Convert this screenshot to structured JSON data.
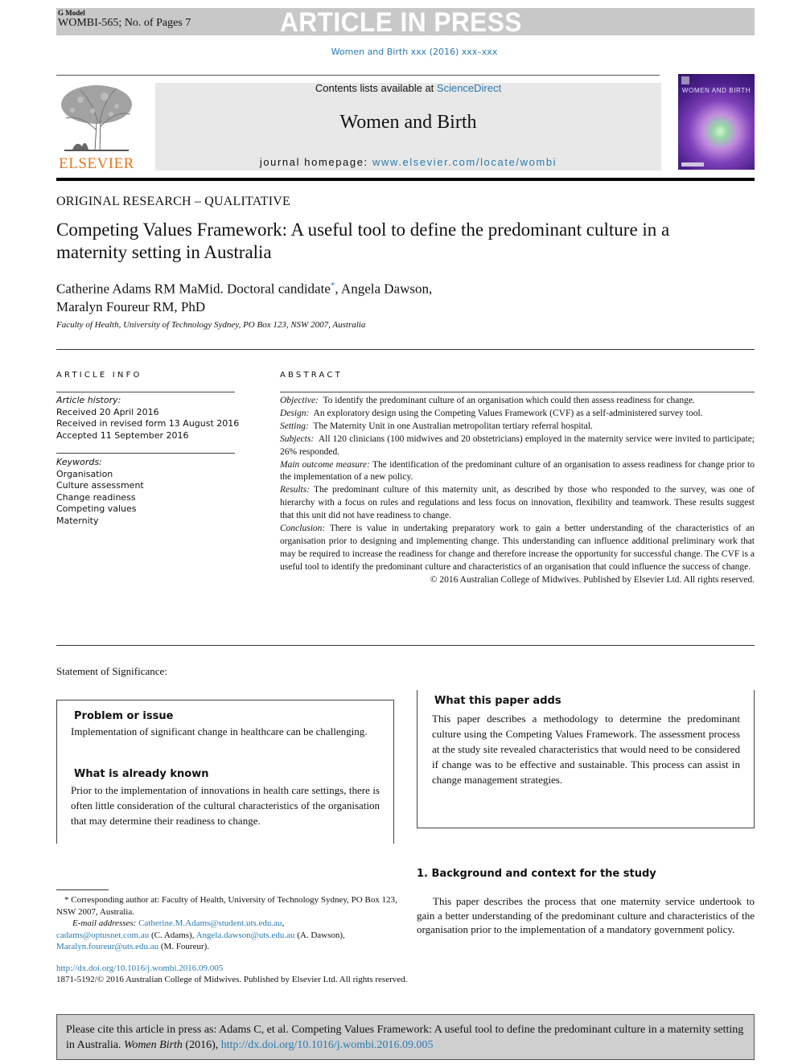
{
  "banner": {
    "model": "G Model",
    "id_pages": "WOMBI-565; No. of Pages 7",
    "status": "ARTICLE IN PRESS"
  },
  "journal_ref": "Women and Birth xxx (2016) xxx–xxx",
  "masthead": {
    "publisher_logo_text": "ELSEVIER",
    "contents_prefix": "Contents lists available at ",
    "contents_link": "ScienceDirect",
    "journal_title": "Women and Birth",
    "homepage_prefix": "journal homepage: ",
    "homepage_link": "www.elsevier.com/locate/wombi",
    "cover_title": "WOMEN AND BIRTH"
  },
  "article": {
    "section": "ORIGINAL RESEARCH – QUALITATIVE",
    "title": "Competing Values Framework: A useful tool to define the predominant culture in a maternity setting in Australia",
    "authors_line1_a": "Catherine Adams RM MaMid. Doctoral candidate",
    "authors_star": "*",
    "authors_line1_b": ", Angela Dawson,",
    "authors_line2": "Maralyn Foureur RM, PhD",
    "affiliation": "Faculty of Health, University of Technology Sydney, PO Box 123, NSW 2007, Australia"
  },
  "article_info": {
    "heading": "ARTICLE INFO",
    "history_label": "Article history:",
    "history": [
      "Received 20 April 2016",
      "Received in revised form 13 August 2016",
      "Accepted 11 September 2016"
    ],
    "keywords_label": "Keywords:",
    "keywords": [
      "Organisation",
      "Culture assessment",
      "Change readiness",
      "Competing values",
      "Maternity"
    ]
  },
  "abstract": {
    "heading": "ABSTRACT",
    "sections": [
      {
        "label": "Objective:",
        "text": "To identify the predominant culture of an organisation which could then assess readiness for change."
      },
      {
        "label": "Design:",
        "text": "An exploratory design using the Competing Values Framework (CVF) as a self-administered survey tool."
      },
      {
        "label": "Setting:",
        "text": "The Maternity Unit in one Australian metropolitan tertiary referral hospital."
      },
      {
        "label": "Subjects:",
        "text": "All 120 clinicians (100 midwives and 20 obstetricians) employed in the maternity service were invited to participate; 26% responded."
      },
      {
        "label": "Main outcome measure:",
        "text": "The identification of the predominant culture of an organisation to assess readiness for change prior to the implementation of a new policy."
      },
      {
        "label": "Results:",
        "text": "The predominant culture of this maternity unit, as described by those who responded to the survey, was one of hierarchy with a focus on rules and regulations and less focus on innovation, flexibility and teamwork. These results suggest that this unit did not have readiness to change."
      },
      {
        "label": "Conclusion:",
        "text": "There is value in undertaking preparatory work to gain a better understanding of the characteristics of an organisation prior to designing and implementing change. This understanding can influence additional preliminary work that may be required to increase the readiness for change and therefore increase the opportunity for successful change. The CVF is a useful tool to identify the predominant culture and characteristics of an organisation that could influence the success of change."
      }
    ],
    "copyright": "© 2016 Australian College of Midwives. Published by Elsevier Ltd. All rights reserved."
  },
  "significance": {
    "label": "Statement of Significance:",
    "problem_heading": "Problem or issue",
    "problem_text": "Implementation of significant change in healthcare can be challenging.",
    "known_heading": "What is already known",
    "known_text": "Prior to the implementation of innovations in health care settings, there is often little consideration of the cultural characteristics of the organisation that may determine their readiness to change.",
    "adds_heading": "What this paper adds",
    "adds_text": "This paper describes a methodology to determine the predominant culture using the Competing Values Framework. The assessment process at the study site revealed characteristics that would need to be considered if change was to be effective and sustainable. This process can assist in change management strategies."
  },
  "footnote": {
    "star": "*",
    "corresponding": "Corresponding author at: Faculty of Health, University of Technology Sydney, PO Box 123, NSW 2007, Australia.",
    "email_label": "E-mail addresses:",
    "emails": [
      {
        "address": "Catherine.M.Adams@student.uts.edu.au",
        "suffix": ","
      },
      {
        "address": "cadams@optusnet.com.au",
        "suffix": " (C. Adams),"
      },
      {
        "address": "Angela.dawson@uts.edu.au",
        "suffix": " (A. Dawson),"
      },
      {
        "address": "Maralyn.foureur@uts.edu.au",
        "suffix": " (M. Foureur)."
      }
    ],
    "doi": "http://dx.doi.org/10.1016/j.wombi.2016.09.005",
    "issn": "1871-5192/© 2016 Australian College of Midwives. Published by Elsevier Ltd. All rights reserved."
  },
  "section1": {
    "heading": "1.  Background and context for the study",
    "paragraph": "This paper describes the process that one maternity service undertook to gain a better understanding of the predominant culture and characteristics of the organisation prior to the implementation of a mandatory government policy."
  },
  "cite": {
    "prefix": "Please cite this article in press as: Adams C, et al. Competing Values Framework: A useful tool to define the predominant culture in a maternity setting in Australia. ",
    "journal": "Women Birth",
    "year": " (2016), ",
    "doi": "http://dx.doi.org/10.1016/j.wombi.2016.09.005"
  }
}
